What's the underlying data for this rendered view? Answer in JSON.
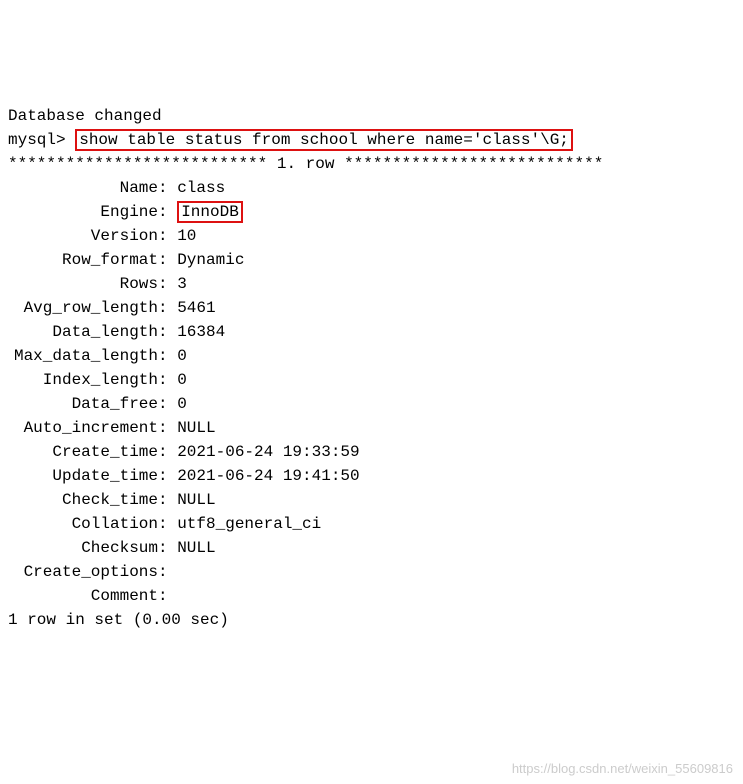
{
  "header": {
    "status": "Database changed",
    "prompt": "mysql>",
    "command": "show table status from school where name='class'\\G;"
  },
  "row_separator": {
    "left": "***************************",
    "label": " 1. row ",
    "right": "***************************"
  },
  "fields": {
    "Name": "class",
    "Engine": "InnoDB",
    "Version": "10",
    "Row_format": "Dynamic",
    "Rows": "3",
    "Avg_row_length": "5461",
    "Data_length": "16384",
    "Max_data_length": "0",
    "Index_length": "0",
    "Data_free": "0",
    "Auto_increment": "NULL",
    "Create_time": "2021-06-24 19:33:59",
    "Update_time": "2021-06-24 19:41:50",
    "Check_time": "NULL",
    "Collation": "utf8_general_ci",
    "Checksum": "NULL",
    "Create_options": "",
    "Comment": ""
  },
  "footer": "1 row in set (0.00 sec)",
  "watermark": "https://blog.csdn.net/weixin_55609816"
}
